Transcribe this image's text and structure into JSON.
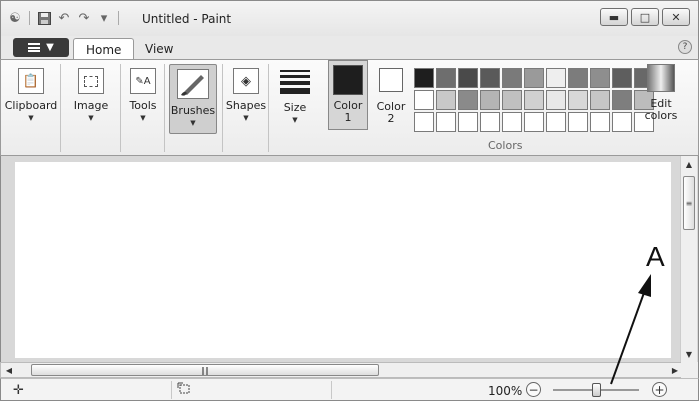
{
  "window": {
    "title": "Untitled - Paint",
    "controls": [
      "minimize",
      "maximize",
      "close"
    ]
  },
  "quick_access": [
    "paint-icon",
    "save-icon",
    "undo-icon",
    "redo-icon",
    "customize-dropdown-icon"
  ],
  "tabs": [
    {
      "label": "Home",
      "active": true
    },
    {
      "label": "View",
      "active": false
    }
  ],
  "ribbon": {
    "clipboard_label": "Clipboard",
    "image_label": "Image",
    "tools_label": "Tools",
    "brushes_label": "Brushes",
    "shapes_label": "Shapes",
    "size_label": "Size",
    "color1_label_top": "Color",
    "color1_label_bottom": "1",
    "color2_label_top": "Color",
    "color2_label_bottom": "2",
    "colors_group_label": "Colors",
    "edit_colors_top": "Edit",
    "edit_colors_bottom": "colors",
    "color1_value": "#1e1e1e",
    "color2_value": "#ffffff",
    "palette": [
      "#1e1e1e",
      "#6e6e6e",
      "#4a4a4a",
      "#5a5a5a",
      "#7a7a7a",
      "#9a9a9a",
      "#eeeeee",
      "#7c7c7c",
      "#8e8e8e",
      "#5e5e5e",
      "#686868",
      "#ffffff",
      "#c8c8c8",
      "#8a8a8a",
      "#b4b4b4",
      "#c0c0c0",
      "#d0d0d0",
      "#e8e8e8",
      "#d8d8d8",
      "#c6c6c6",
      "#7e7e7e",
      "#bcbcbc",
      "#ffffff",
      "#ffffff",
      "#ffffff",
      "#ffffff",
      "#ffffff",
      "#ffffff",
      "#ffffff",
      "#ffffff",
      "#ffffff",
      "#ffffff",
      "#ffffff"
    ]
  },
  "status": {
    "zoom_text": "100%",
    "zoom_level": 1.0
  },
  "annotation": {
    "letter": "A"
  }
}
